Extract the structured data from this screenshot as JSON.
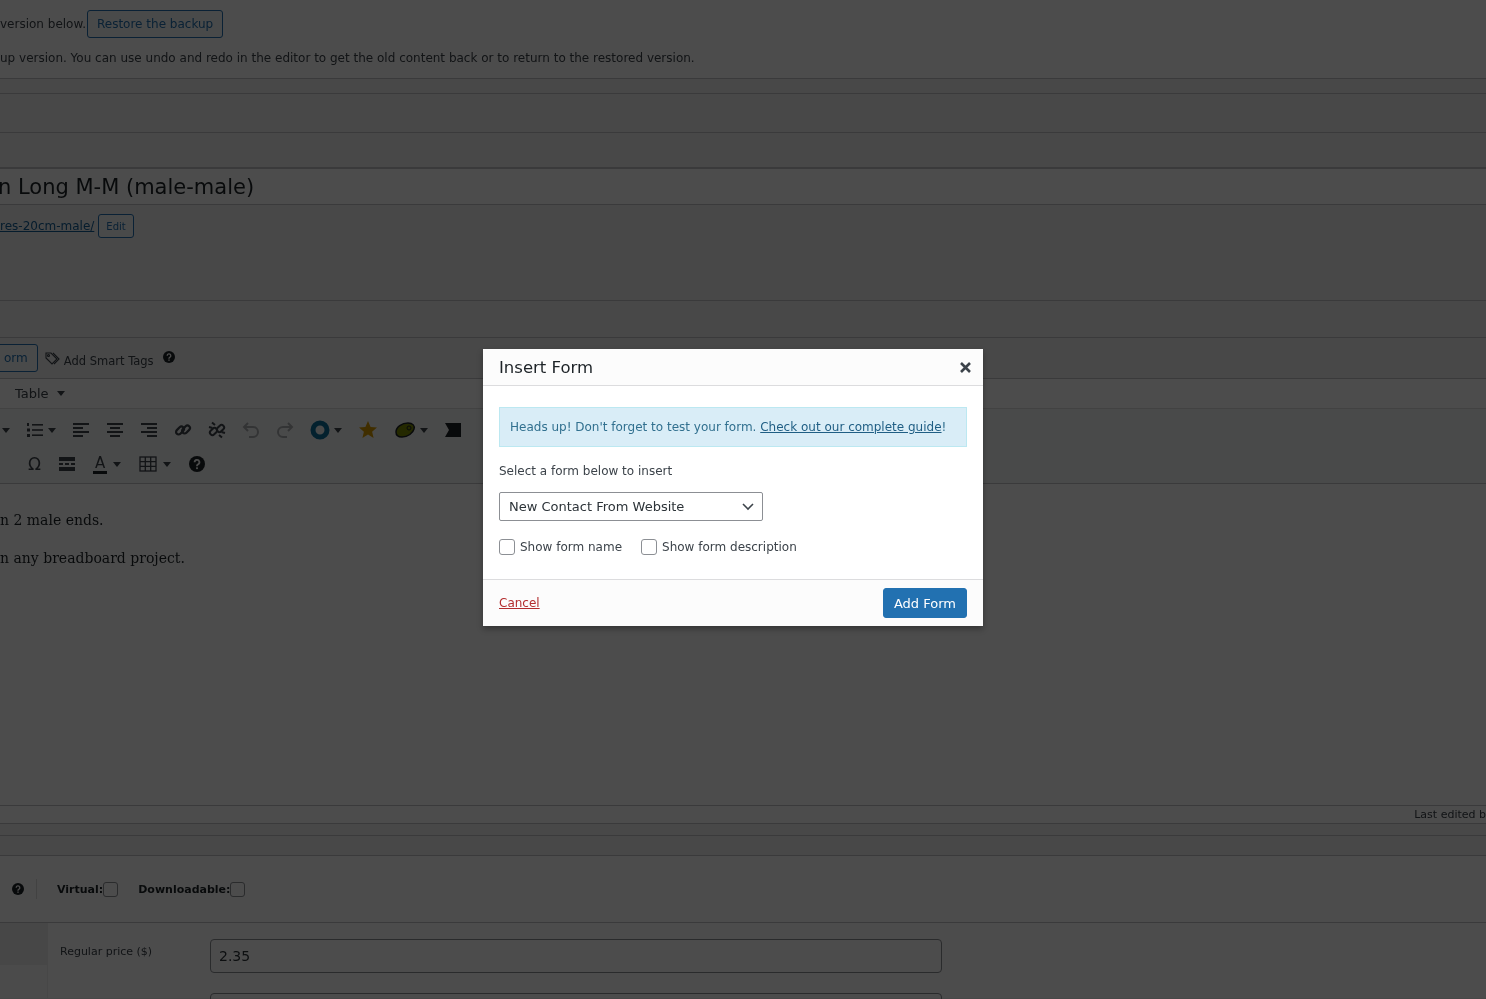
{
  "notice": {
    "text_1": "version below.",
    "restore_button": "Restore the backup",
    "text_2": "up version. You can use undo and redo in the editor to get the old content back or to return to the restored version."
  },
  "title": "n Long M-M (male-male)",
  "permalink": {
    "link": "res-20cm-male/",
    "edit_button": "Edit"
  },
  "media_bar": {
    "form_button": "orm",
    "smart_tags": "Add Smart Tags"
  },
  "menubar": [
    {
      "label": "Table"
    }
  ],
  "toolbar": {
    "row_1": [
      {
        "kind": "caret",
        "disabled": false
      },
      {
        "kind": "ordered-list",
        "disabled": false
      },
      {
        "kind": "caret",
        "disabled": false
      },
      {
        "kind": "align-left",
        "disabled": false
      },
      {
        "kind": "align-center",
        "disabled": false
      },
      {
        "kind": "align-right",
        "disabled": false
      },
      {
        "kind": "link",
        "disabled": false
      },
      {
        "kind": "unlink",
        "disabled": false
      },
      {
        "kind": "undo",
        "disabled": true
      },
      {
        "kind": "redo",
        "disabled": true
      },
      {
        "kind": "ring",
        "disabled": false
      },
      {
        "kind": "caret",
        "disabled": false
      },
      {
        "kind": "star",
        "disabled": false
      },
      {
        "kind": "blob",
        "disabled": false
      },
      {
        "kind": "caret",
        "disabled": false
      },
      {
        "kind": "ticket",
        "disabled": false
      }
    ],
    "row_2": [
      {
        "kind": "glyph",
        "label": "Ω",
        "disabled": false
      },
      {
        "kind": "hr",
        "disabled": false
      },
      {
        "kind": "text-color",
        "label": "A",
        "disabled": false
      },
      {
        "kind": "caret",
        "disabled": false
      },
      {
        "kind": "table",
        "disabled": false
      },
      {
        "kind": "caret",
        "disabled": false
      },
      {
        "kind": "help",
        "disabled": false
      }
    ]
  },
  "content": [
    "n 2 male ends.",
    "n any breadboard project."
  ],
  "status_bar": "Last edited b",
  "product": {
    "virtual": {
      "label": "Virtual:",
      "checked": false
    },
    "downloadable": {
      "label": "Downloadable:",
      "checked": false
    },
    "regular_price": {
      "label": "Regular price ($)",
      "value": "2.35"
    }
  },
  "modal": {
    "title": "Insert Form",
    "notice": "Heads up! Don't forget to test your form. ",
    "notice_link": "Check out our complete guide",
    "notice_end": "!",
    "select_label": "Select a form below to insert",
    "select_value": "New Contact From Website",
    "options": [
      {
        "label": "Show form name",
        "checked": false
      },
      {
        "label": "Show form description",
        "checked": false
      }
    ],
    "cancel": "Cancel",
    "submit": "Add Form"
  }
}
